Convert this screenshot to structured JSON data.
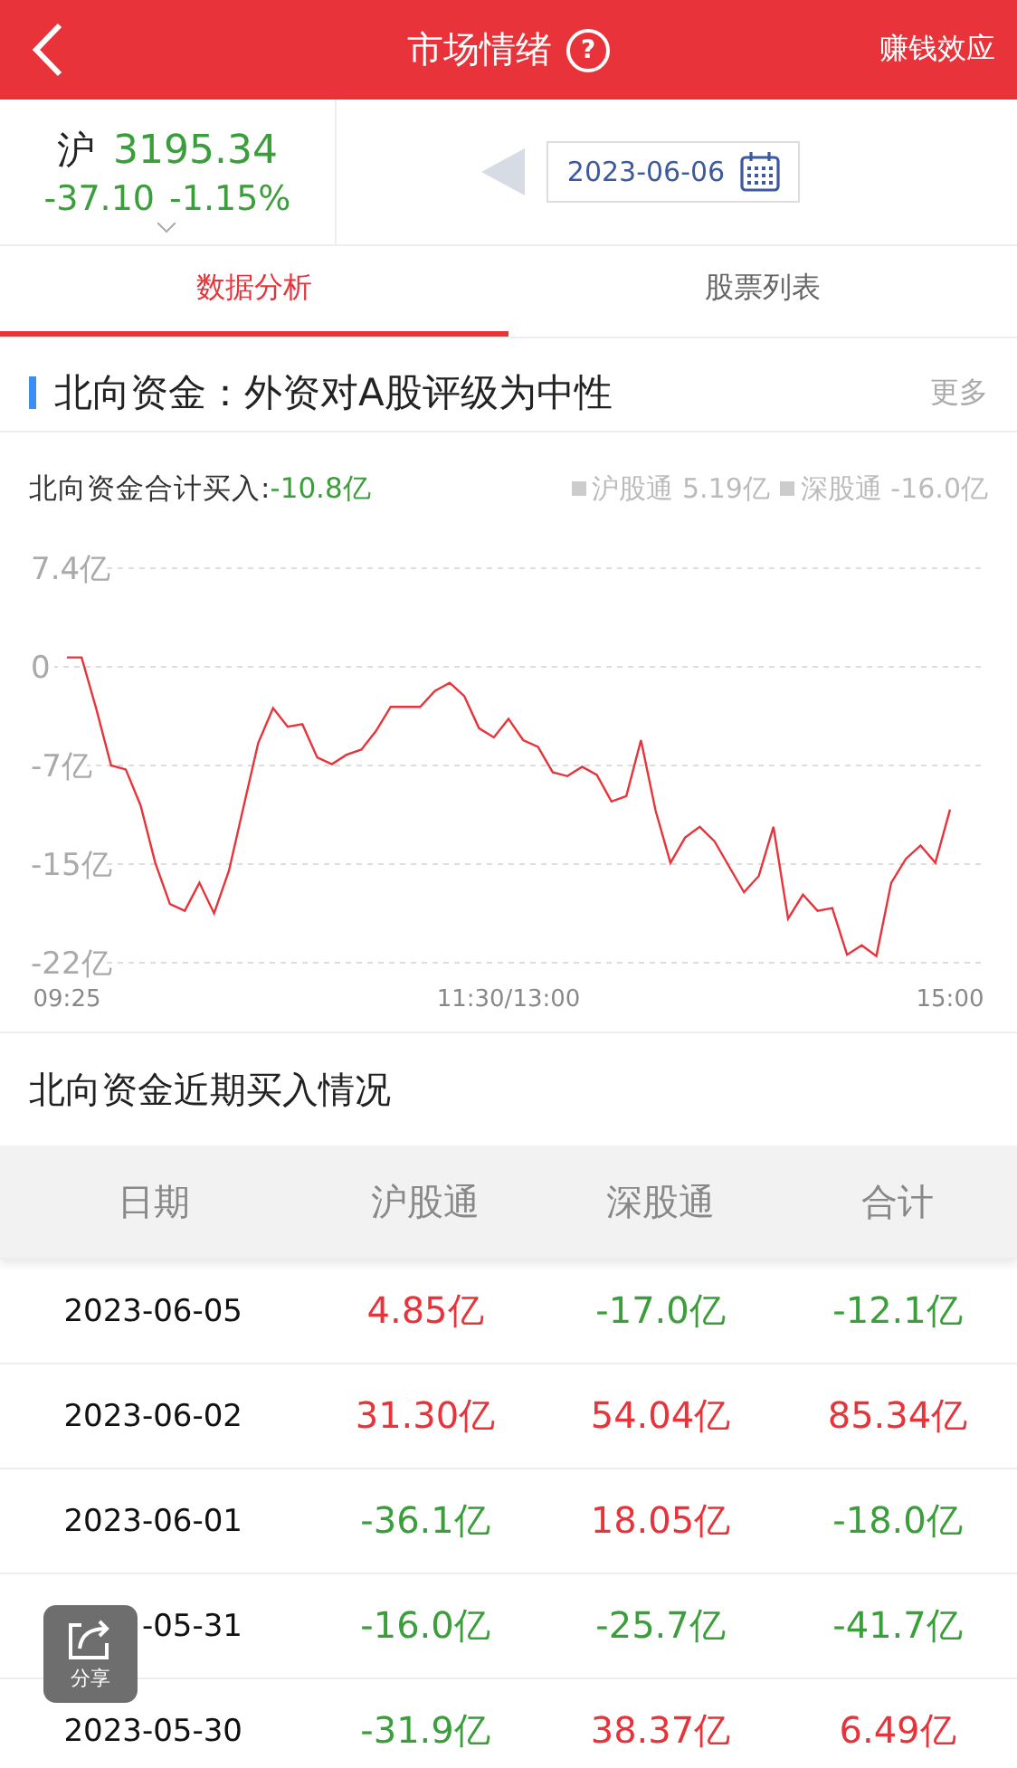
{
  "header": {
    "title": "市场情绪",
    "help": "?",
    "right_link": "赚钱效应"
  },
  "index": {
    "name": "沪",
    "value": "3195.34",
    "change": "-37.10",
    "percent": "-1.15%",
    "color": "#3a9e3a",
    "date": "2023-06-06"
  },
  "tabs": [
    {
      "label": "数据分析",
      "selected": true
    },
    {
      "label": "股票列表",
      "selected": false
    }
  ],
  "section": {
    "title": "北向资金：外资对A股评级为中性",
    "more": "更多",
    "summary_label": "北向资金合计买入:",
    "summary_value": "-10.8亿",
    "legend": [
      {
        "label": "沪股通 5.19亿"
      },
      {
        "label": "深股通 -16.0亿"
      }
    ],
    "chart_data": {
      "type": "line",
      "categories": [
        "09:25",
        null,
        null,
        null,
        null,
        null,
        null,
        null,
        null,
        null,
        null,
        null,
        null,
        null,
        null,
        null,
        null,
        null,
        null,
        null,
        null,
        null,
        null,
        null,
        null,
        null,
        null,
        null,
        null,
        null,
        "11:30/13:00",
        null,
        null,
        null,
        null,
        null,
        null,
        null,
        null,
        null,
        null,
        null,
        null,
        null,
        null,
        null,
        null,
        null,
        null,
        null,
        null,
        null,
        null,
        null,
        null,
        null,
        null,
        null,
        null,
        null,
        "15:00"
      ],
      "series": [
        {
          "color": "#e8333a",
          "values": [
            0.7,
            0.7,
            -3.2,
            -7.4,
            -7.7,
            -10.4,
            -14.7,
            -17.8,
            -18.3,
            -16.2,
            -18.5,
            -15.3,
            -10.5,
            -5.7,
            -3.1,
            -4.5,
            -4.3,
            -6.8,
            -7.3,
            -6.6,
            -6.2,
            -4.8,
            -3.0,
            -3.0,
            -3.0,
            -1.8,
            -1.2,
            -2.2,
            -4.6,
            -5.3,
            -3.9,
            -5.5,
            -6.0,
            -7.9,
            -8.2,
            -7.5,
            -8.1,
            -10.1,
            -9.7,
            -5.5,
            -10.8,
            -14.7,
            -12.8,
            -12.0,
            -13.1,
            -15.0,
            -16.9,
            -15.7,
            -12.0,
            -18.9,
            -17.1,
            -18.3,
            -18.1,
            -21.6,
            -20.9,
            -21.7,
            -16.2,
            -14.4,
            -13.4,
            -14.7,
            -10.7
          ]
        }
      ],
      "ylim": [
        -22.2,
        7.4
      ],
      "grid": true,
      "yticks": [
        {
          "value": 7.4,
          "label": "7.4亿"
        },
        {
          "value": 0,
          "label": "0"
        },
        {
          "value": -7.4,
          "label": "-7亿"
        },
        {
          "value": -14.8,
          "label": "-15亿"
        },
        {
          "value": -22.2,
          "label": "-22亿"
        }
      ]
    }
  },
  "table": {
    "title": "北向资金近期买入情况",
    "columns": [
      "日期",
      "沪股通",
      "深股通",
      "合计"
    ],
    "rows": [
      {
        "cells": [
          {
            "text": "2023-06-05"
          },
          {
            "text": "4.85亿",
            "color": "#e8333a"
          },
          {
            "text": "-17.0亿",
            "color": "#3a9e3a"
          },
          {
            "text": "-12.1亿",
            "color": "#3a9e3a"
          }
        ]
      },
      {
        "cells": [
          {
            "text": "2023-06-02"
          },
          {
            "text": "31.30亿",
            "color": "#e8333a"
          },
          {
            "text": "54.04亿",
            "color": "#e8333a"
          },
          {
            "text": "85.34亿",
            "color": "#e8333a"
          }
        ]
      },
      {
        "cells": [
          {
            "text": "2023-06-01"
          },
          {
            "text": "-36.1亿",
            "color": "#3a9e3a"
          },
          {
            "text": "18.05亿",
            "color": "#e8333a"
          },
          {
            "text": "-18.0亿",
            "color": "#3a9e3a"
          }
        ]
      },
      {
        "cells": [
          {
            "text": "-05-31"
          },
          {
            "text": "-16.0亿",
            "color": "#3a9e3a"
          },
          {
            "text": "-25.7亿",
            "color": "#3a9e3a"
          },
          {
            "text": "-41.7亿",
            "color": "#3a9e3a"
          }
        ]
      },
      {
        "cells": [
          {
            "text": "2023-05-30"
          },
          {
            "text": "-31.9亿",
            "color": "#3a9e3a"
          },
          {
            "text": "38.37亿",
            "color": "#e8333a"
          },
          {
            "text": "6.49亿",
            "color": "#e8333a"
          }
        ]
      }
    ]
  },
  "share": {
    "label": "分享"
  }
}
